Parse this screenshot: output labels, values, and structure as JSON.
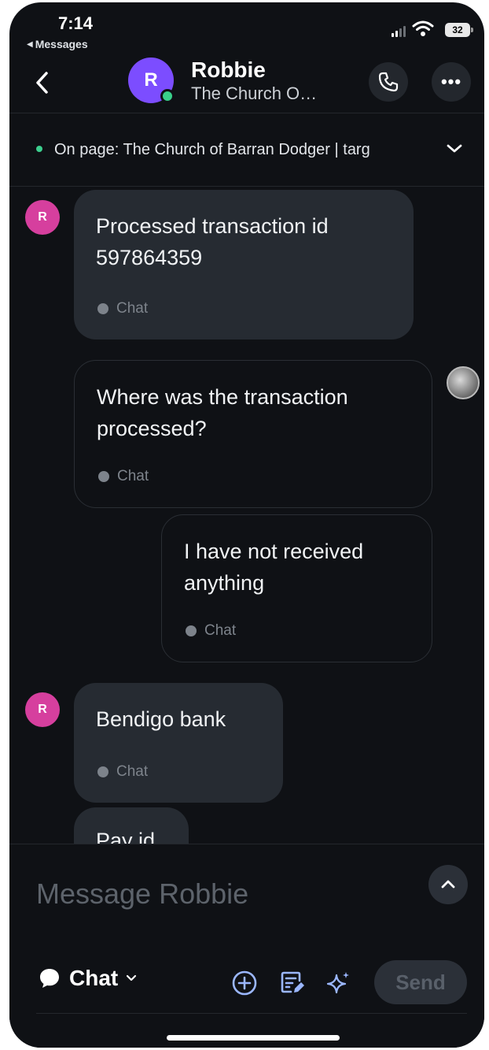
{
  "status_bar": {
    "time": "7:14",
    "back_app": "Messages",
    "battery": "32"
  },
  "header": {
    "avatar_initial": "R",
    "name": "Robbie",
    "subtitle": "The Church O…"
  },
  "page_banner": {
    "text": "On page: The Church of Barran Dodger | targ"
  },
  "messages": [
    {
      "direction": "in",
      "avatar_initial": "R",
      "text": "Processed transaction id 597864359",
      "channel": "Chat"
    },
    {
      "direction": "out",
      "text": "Where was the transaction processed?",
      "channel": "Chat"
    },
    {
      "direction": "out",
      "text": "I have not received anything",
      "channel": "Chat"
    },
    {
      "direction": "in",
      "avatar_initial": "R",
      "text": "Bendigo bank",
      "channel": "Chat"
    },
    {
      "direction": "in",
      "text": "Pay id",
      "channel": ""
    }
  ],
  "composer": {
    "placeholder": "Message Robbie",
    "channel_label": "Chat",
    "send_label": "Send"
  },
  "colors": {
    "background": "#0f1115",
    "incoming_bubble": "#262b32",
    "contact_avatar": "#7c4dff",
    "message_avatar": "#d63f9e",
    "online": "#39d08a"
  },
  "icons": {
    "back": "chevron-left-icon",
    "call": "phone-icon",
    "more": "ellipsis-icon",
    "banner": "chevron-down-icon",
    "expand": "chevron-up-icon",
    "add": "plus-circle-icon",
    "template": "compose-icon",
    "ai": "sparkle-icon"
  }
}
